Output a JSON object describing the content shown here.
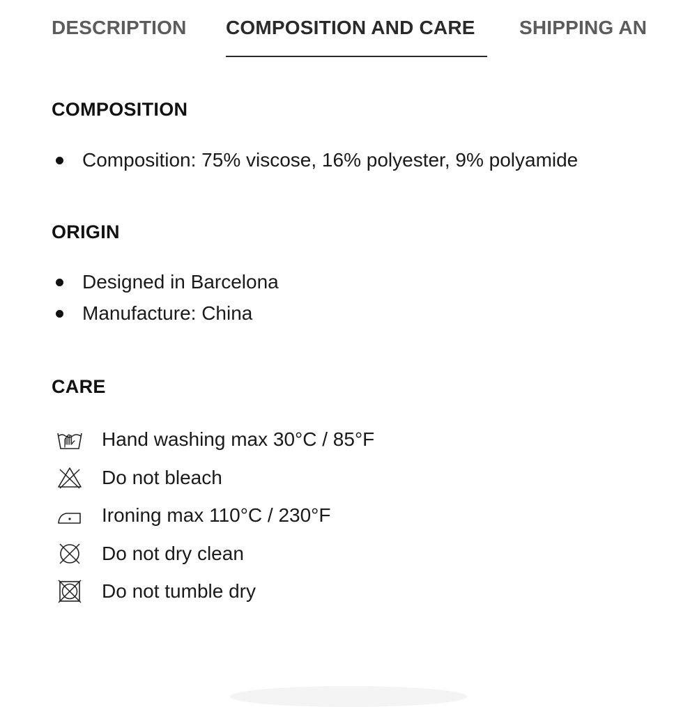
{
  "tabs": [
    {
      "label": "DESCRIPTION",
      "active": false
    },
    {
      "label": "COMPOSITION AND CARE",
      "active": true
    },
    {
      "label": "SHIPPING AN",
      "active": false
    }
  ],
  "composition": {
    "title": "COMPOSITION",
    "items": [
      "Composition: 75% viscose, 16% polyester, 9% polyamide"
    ]
  },
  "origin": {
    "title": "ORIGIN",
    "items": [
      "Designed in Barcelona",
      "Manufacture: China"
    ]
  },
  "care": {
    "title": "CARE",
    "items": [
      {
        "icon": "hand-wash-icon",
        "label": "Hand washing max 30°C / 85°F"
      },
      {
        "icon": "no-bleach-icon",
        "label": "Do not bleach"
      },
      {
        "icon": "iron-low-icon",
        "label": "Ironing max 110°C / 230°F"
      },
      {
        "icon": "no-dry-clean-icon",
        "label": "Do not dry clean"
      },
      {
        "icon": "no-tumble-dry-icon",
        "label": "Do not tumble dry"
      }
    ]
  },
  "colors": {
    "text": "#1a1a1a",
    "tab_inactive": "#5c5c5c",
    "tab_active": "#2a2a2a"
  }
}
